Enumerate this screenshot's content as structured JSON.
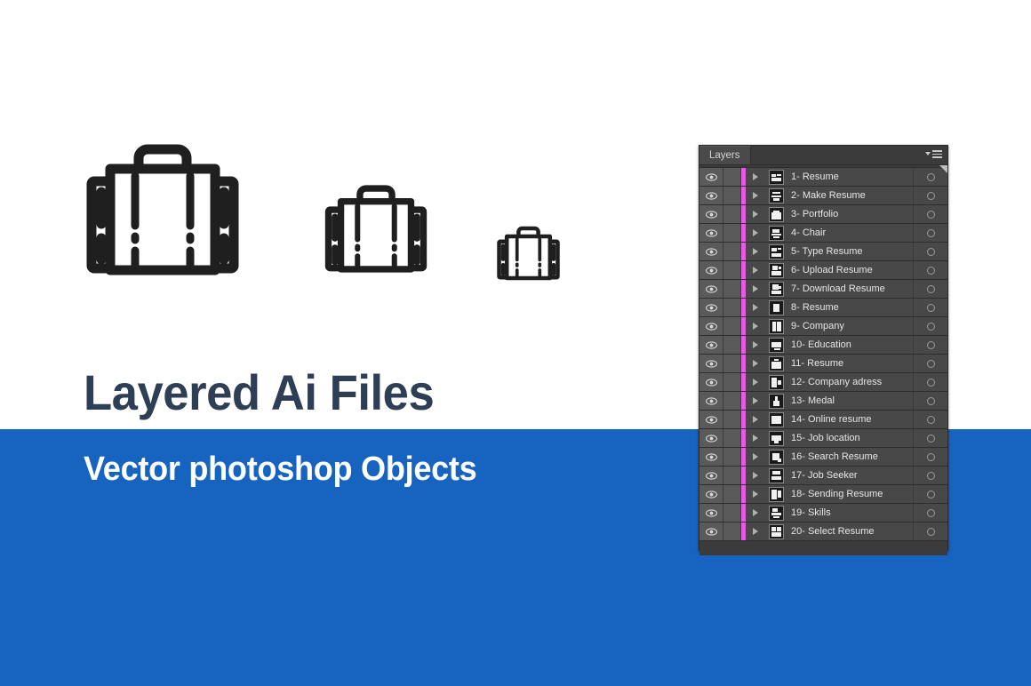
{
  "canvas": {
    "background_color": "#ffffff",
    "band_color": "#1664c0"
  },
  "promo": {
    "headline": "Layered Ai Files",
    "headline_color": "#2d3e55",
    "subhead": "Vector photoshop Objects",
    "subhead_color": "#ffffff"
  },
  "artwork": {
    "icon_color": "#1f1f1f",
    "items": [
      {
        "name": "briefcase-icon-large",
        "size": "large"
      },
      {
        "name": "briefcase-icon-medium",
        "size": "medium"
      },
      {
        "name": "briefcase-icon-small",
        "size": "small"
      }
    ]
  },
  "layers_panel": {
    "tab_label": "Layers",
    "menu_icon": "panel-menu-icon",
    "row_color_marker": "#e45ce4",
    "rows": [
      {
        "label": "1- Resume",
        "visible": true,
        "expand": "collapsed",
        "thumb": "resume-icon"
      },
      {
        "label": "2- Make Resume",
        "visible": true,
        "expand": "collapsed",
        "thumb": "make-resume-icon"
      },
      {
        "label": "3- Portfolio",
        "visible": true,
        "expand": "collapsed",
        "thumb": "portfolio-icon"
      },
      {
        "label": "4- Chair",
        "visible": true,
        "expand": "collapsed",
        "thumb": "chair-icon"
      },
      {
        "label": "5- Type Resume",
        "visible": true,
        "expand": "collapsed",
        "thumb": "type-resume-icon"
      },
      {
        "label": "6- Upload Resume",
        "visible": true,
        "expand": "collapsed",
        "thumb": "upload-resume-icon"
      },
      {
        "label": "7- Download Resume",
        "visible": true,
        "expand": "collapsed",
        "thumb": "download-resume-icon"
      },
      {
        "label": "8- Resume",
        "visible": true,
        "expand": "collapsed",
        "thumb": "resume-person-icon"
      },
      {
        "label": "9- Company",
        "visible": true,
        "expand": "collapsed",
        "thumb": "company-icon"
      },
      {
        "label": "10- Education",
        "visible": true,
        "expand": "collapsed",
        "thumb": "education-icon"
      },
      {
        "label": "11- Resume",
        "visible": true,
        "expand": "collapsed",
        "thumb": "briefcase-icon"
      },
      {
        "label": "12- Company adress",
        "visible": true,
        "expand": "collapsed",
        "thumb": "company-address-icon"
      },
      {
        "label": "13- Medal",
        "visible": true,
        "expand": "collapsed",
        "thumb": "medal-icon"
      },
      {
        "label": "14- Online resume",
        "visible": true,
        "expand": "collapsed",
        "thumb": "online-resume-icon"
      },
      {
        "label": "15- Job location",
        "visible": true,
        "expand": "collapsed",
        "thumb": "job-location-icon"
      },
      {
        "label": "16- Search Resume",
        "visible": true,
        "expand": "collapsed",
        "thumb": "search-resume-icon"
      },
      {
        "label": "17- Job Seeker",
        "visible": true,
        "expand": "collapsed",
        "thumb": "job-seeker-icon"
      },
      {
        "label": "18- Sending Resume",
        "visible": true,
        "expand": "collapsed",
        "thumb": "sending-resume-icon"
      },
      {
        "label": "19- Skills",
        "visible": true,
        "expand": "collapsed",
        "thumb": "skills-icon"
      },
      {
        "label": "20- Select Resume",
        "visible": true,
        "expand": "collapsed",
        "thumb": "select-resume-icon"
      }
    ]
  }
}
